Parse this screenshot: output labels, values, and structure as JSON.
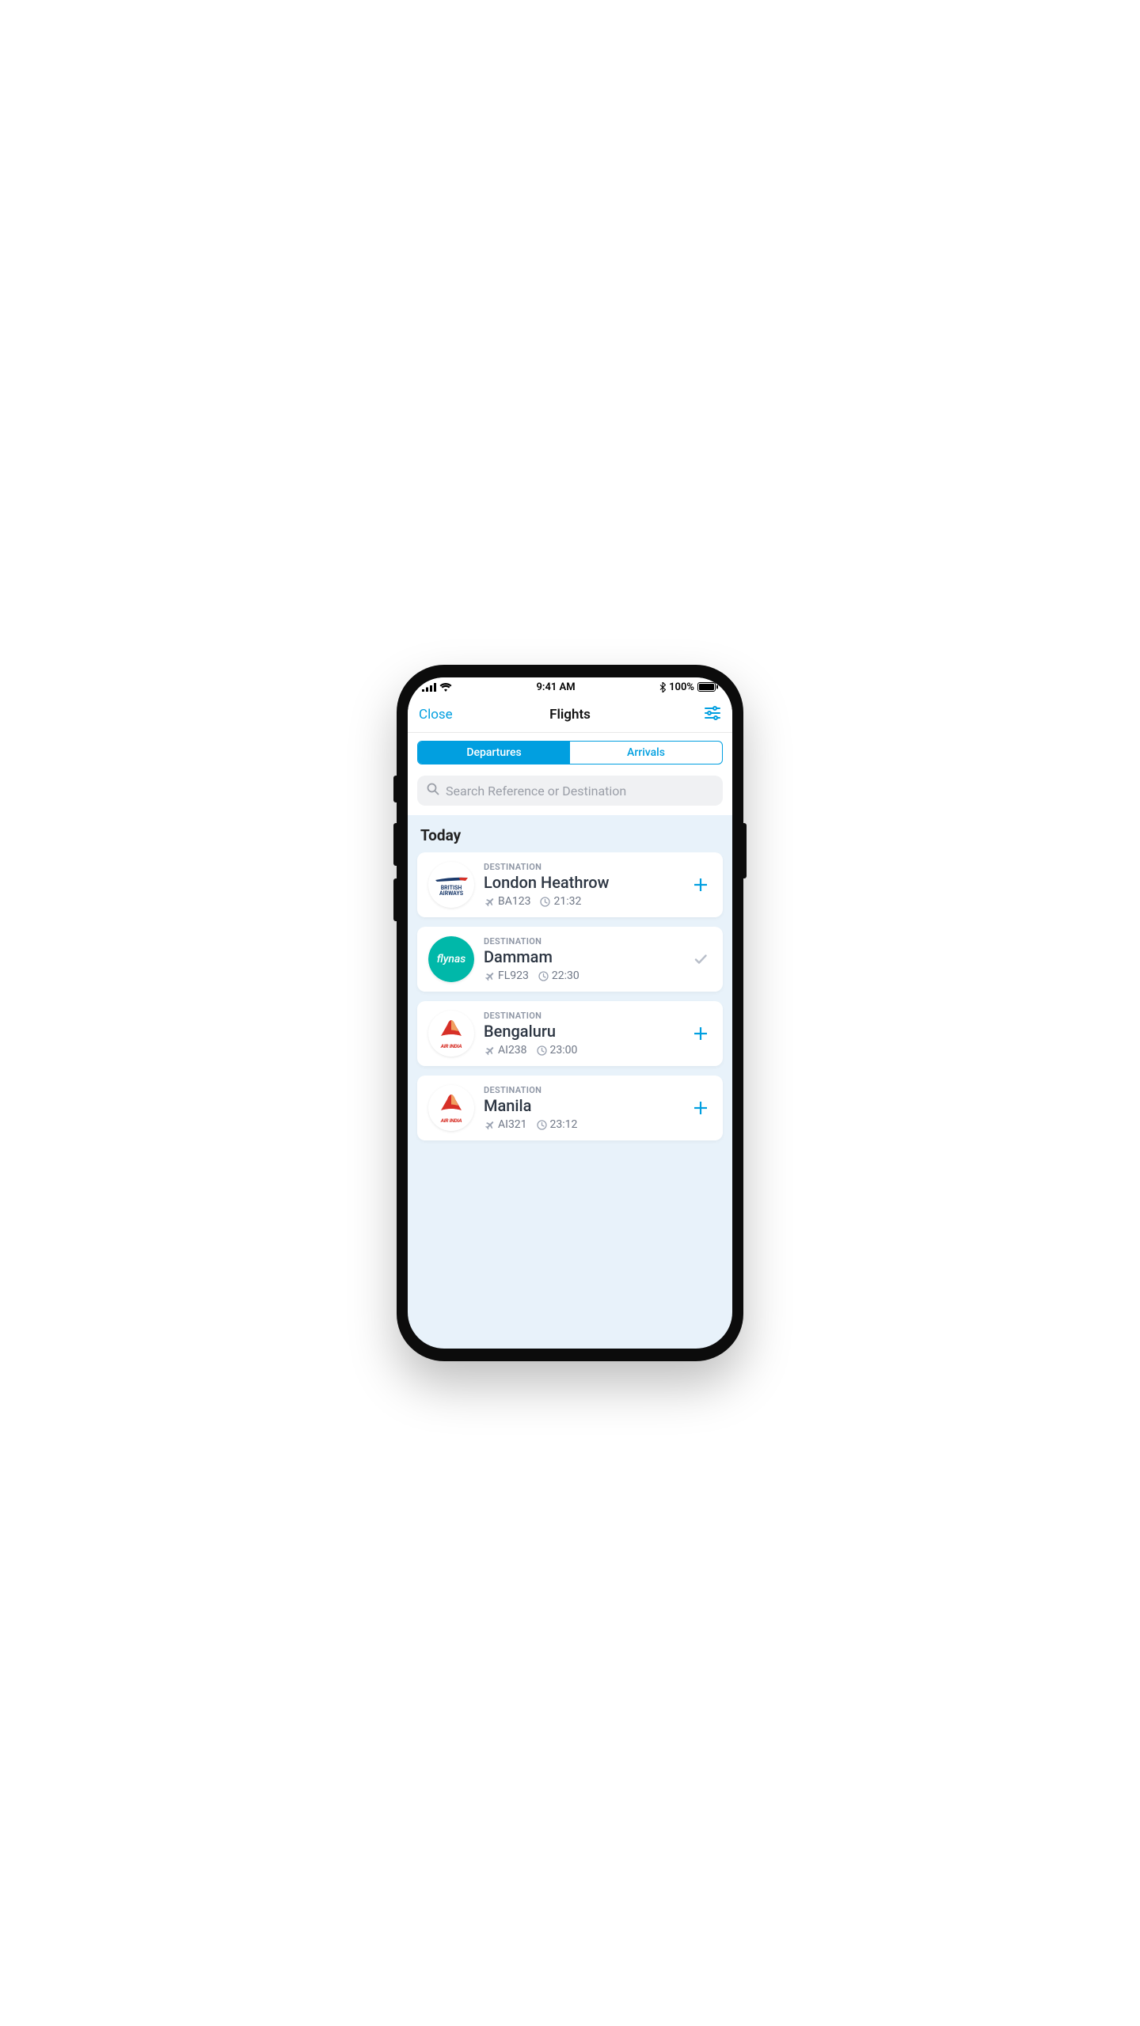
{
  "status_bar": {
    "time": "9:41 AM",
    "battery_pct": "100%"
  },
  "nav": {
    "close_label": "Close",
    "title": "Flights"
  },
  "segmented": {
    "tabs": [
      {
        "label": "Departures",
        "active": true
      },
      {
        "label": "Arrivals",
        "active": false
      }
    ]
  },
  "search": {
    "placeholder": "Search Reference or Destination"
  },
  "section": {
    "title": "Today"
  },
  "labels": {
    "destination": "DESTINATION"
  },
  "flights": [
    {
      "airline": "british-airways",
      "airline_display": "BRITISH AIRWAYS",
      "destination": "London Heathrow",
      "ref": "BA123",
      "time": "21:32",
      "action": "add"
    },
    {
      "airline": "flynas",
      "airline_display": "flynas",
      "destination": "Dammam",
      "ref": "FL923",
      "time": "22:30",
      "action": "done"
    },
    {
      "airline": "air-india",
      "airline_display": "AIR INDIA",
      "destination": "Bengaluru",
      "ref": "AI238",
      "time": "23:00",
      "action": "add"
    },
    {
      "airline": "air-india",
      "airline_display": "AIR INDIA",
      "destination": "Manila",
      "ref": "AI321",
      "time": "23:12",
      "action": "add"
    }
  ],
  "colors": {
    "accent": "#019fe0",
    "flynas": "#00b8a9",
    "air_india": "#d73027",
    "ba_blue": "#1b3a6b"
  }
}
